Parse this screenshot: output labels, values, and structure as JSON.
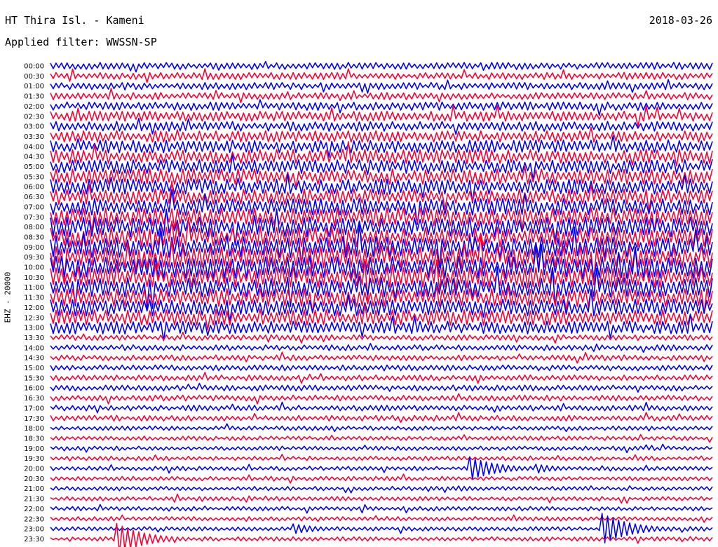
{
  "header": {
    "station": "HT Thira Isl. - Kameni",
    "date": "2018-03-26",
    "filter": "Applied filter: WWSSN-SP",
    "channel": "EHZ - 20000"
  },
  "chart_data": {
    "type": "line",
    "subtype": "helicorder",
    "title": "HT Thira Isl. - Kameni",
    "date": "2018-03-26",
    "filter": "WWSSN-SP",
    "ylabel": "EHZ - 20000",
    "row_labels": [
      "00:00",
      "00:30",
      "01:00",
      "01:30",
      "02:00",
      "02:30",
      "03:00",
      "03:30",
      "04:00",
      "04:30",
      "05:00",
      "05:30",
      "06:00",
      "06:30",
      "07:00",
      "07:30",
      "08:00",
      "08:30",
      "09:00",
      "09:30",
      "10:00",
      "10:30",
      "11:00",
      "11:30",
      "12:00",
      "12:30",
      "13:00",
      "13:30",
      "14:00",
      "14:30",
      "15:00",
      "15:30",
      "16:00",
      "16:30",
      "17:00",
      "17:30",
      "18:00",
      "18:30",
      "19:00",
      "19:30",
      "20:00",
      "20:30",
      "21:00",
      "21:30",
      "22:00",
      "22:30",
      "23:00",
      "23:30"
    ],
    "row_colors": [
      "#0000ff",
      "#ff0033"
    ],
    "noise_level": [
      5,
      5,
      5,
      5,
      6,
      7,
      7,
      8,
      9,
      10,
      10,
      11,
      11,
      11,
      12,
      13,
      14,
      14,
      15,
      16,
      16,
      15,
      14,
      13,
      12,
      11,
      9,
      4,
      4,
      4,
      4,
      4,
      4,
      4,
      4,
      4,
      3,
      3,
      3,
      3,
      3,
      3,
      3,
      3,
      3,
      3,
      3,
      3
    ],
    "events": [
      {
        "row": "20:00",
        "minute": 18.9,
        "amplitude": 18
      },
      {
        "row": "20:00",
        "minute": 22.0,
        "amplitude": 6
      },
      {
        "row": "21:00",
        "minute": 18.4,
        "amplitude": 4
      },
      {
        "row": "23:00",
        "minute": 11.0,
        "amplitude": 7
      },
      {
        "row": "23:00",
        "minute": 25.0,
        "amplitude": 22
      },
      {
        "row": "23:30",
        "minute": 3.0,
        "amplitude": 22
      }
    ]
  }
}
